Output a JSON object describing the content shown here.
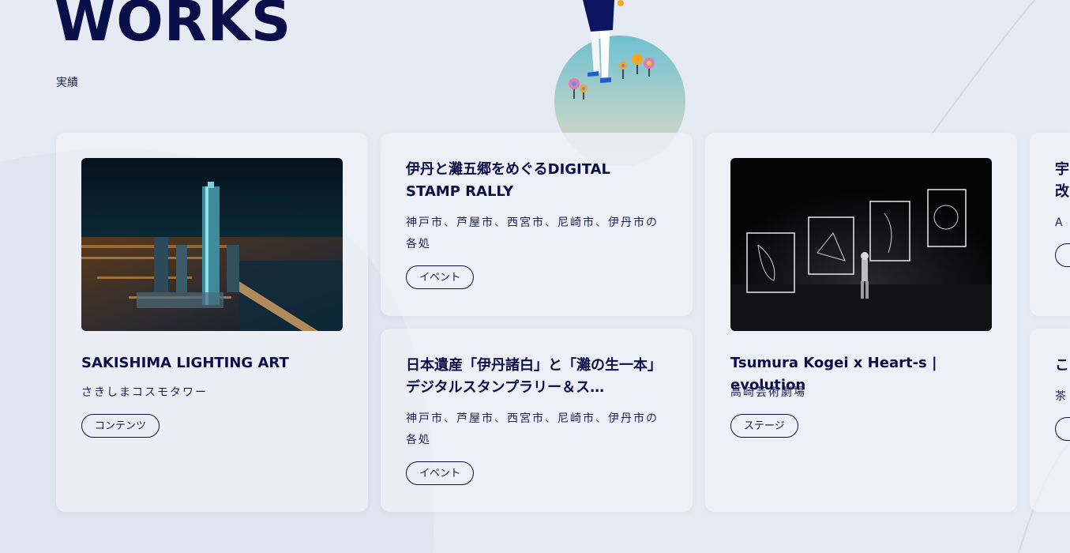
{
  "section": {
    "title": "WORKS",
    "subtitle": "実績"
  },
  "cards": [
    {
      "title": "SAKISHIMA LIGHTING ART",
      "location": "さきしまコスモタワー",
      "tag": "コンテンツ",
      "image": "night-city-tower-photo"
    },
    {
      "title": "伊丹と灘五郷をめぐるDIGITAL STAMP RALLY",
      "location": "神戸市、芦屋市、西宮市、尼崎市、伊丹市の各処",
      "tag": "イベント"
    },
    {
      "title": "日本遺産「伊丹諸白」と「灘の生一本」デジタルスタンプラリー＆ス…",
      "location": "神戸市、芦屋市、西宮市、尼崎市、伊丹市の各処",
      "tag": "イベント"
    },
    {
      "title": "Tsumura Kogei x Heart-s | evolution",
      "location": "高崎芸術劇場",
      "tag": "ステージ",
      "image": "stage-performance-photo"
    },
    {
      "title": "宇\n改",
      "location": "A",
      "tag": ""
    },
    {
      "title": "こ",
      "location": "茶",
      "tag": ""
    }
  ],
  "colors": {
    "background": "#e6eaf2",
    "card": "#eef1f7",
    "text": "#0a0f4a",
    "accent_orange": "#f5a623",
    "accent_pink": "#e07bb5"
  }
}
